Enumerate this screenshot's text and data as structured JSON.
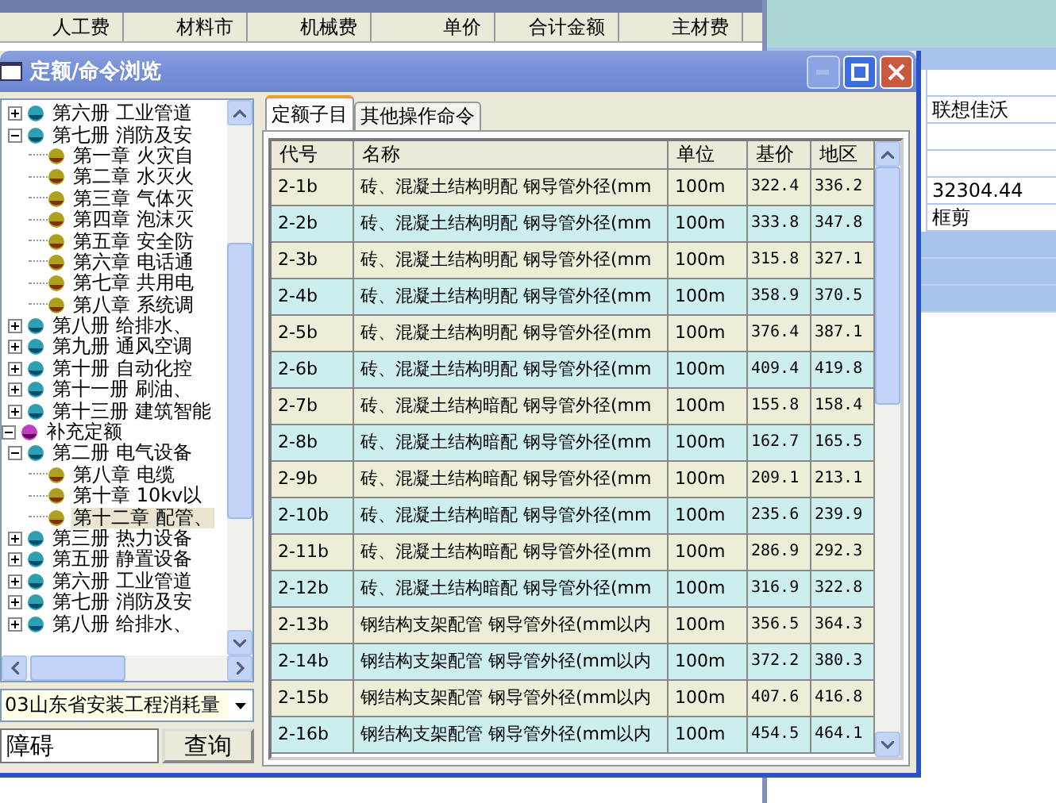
{
  "background": {
    "columns": [
      "人工费",
      "材料市",
      "机械费",
      "单价",
      "合计金额",
      "主材费"
    ],
    "side_cells": [
      "",
      "联想佳沃",
      "",
      "",
      "32304.44",
      "框剪"
    ]
  },
  "window": {
    "title": "定额/命令浏览"
  },
  "tree": [
    {
      "children": [
        {
          "label": "第六册  工业管道",
          "kind": "book",
          "expanded": false
        },
        {
          "label": "第七册  消防及安",
          "kind": "book",
          "expanded": true,
          "children": [
            {
              "label": "第一章  火灾自",
              "kind": "chapter",
              "selected": false
            },
            {
              "label": "第二章  水灭火",
              "kind": "chapter",
              "selected": false
            },
            {
              "label": "第三章  气体灭",
              "kind": "chapter",
              "selected": false
            },
            {
              "label": "第四章  泡沫灭",
              "kind": "chapter",
              "selected": false
            },
            {
              "label": "第五章  安全防",
              "kind": "chapter",
              "selected": false
            },
            {
              "label": "第六章  电话通",
              "kind": "chapter",
              "selected": false
            },
            {
              "label": "第七章  共用电",
              "kind": "chapter",
              "selected": false
            },
            {
              "label": "第八章  系统调",
              "kind": "chapter",
              "selected": false
            }
          ]
        },
        {
          "label": "第八册  给排水、",
          "kind": "book",
          "expanded": false
        },
        {
          "label": "第九册  通风空调",
          "kind": "book",
          "expanded": false
        },
        {
          "label": "第十册  自动化控",
          "kind": "book",
          "expanded": false
        },
        {
          "label": "第十一册  刷油、",
          "kind": "book",
          "expanded": false
        },
        {
          "label": "第十三册  建筑智能",
          "kind": "book",
          "expanded": false
        }
      ]
    },
    {
      "label": "补充定额",
      "kind": "root",
      "expanded": true,
      "children": [
        {
          "label": "第二册  电气设备",
          "kind": "book",
          "expanded": true,
          "children": [
            {
              "label": "第八章  电缆",
              "kind": "chapter",
              "selected": false
            },
            {
              "label": "第十章  10kv以",
              "kind": "chapter",
              "selected": false
            },
            {
              "label": "第十二章  配管、",
              "kind": "chapter",
              "selected": true
            }
          ]
        },
        {
          "label": "第三册  热力设备",
          "kind": "book",
          "expanded": false
        },
        {
          "label": "第五册  静置设备",
          "kind": "book",
          "expanded": false
        },
        {
          "label": "第六册  工业管道",
          "kind": "book",
          "expanded": false
        },
        {
          "label": "第七册  消防及安",
          "kind": "book",
          "expanded": false
        },
        {
          "label": "第八册  给排水、",
          "kind": "book",
          "expanded": false
        }
      ]
    }
  ],
  "library_select": {
    "value": "03山东省安装工程消耗量"
  },
  "search": {
    "value": "障碍",
    "button": "查询"
  },
  "tabs": [
    {
      "label": "定额子目",
      "selected": true
    },
    {
      "label": "其他操作命令",
      "selected": false
    }
  ],
  "table": {
    "columns": [
      "代号",
      "名称",
      "单位",
      "基价",
      "地区"
    ],
    "rows": [
      [
        "2-1b",
        "砖、混凝土结构明配 钢导管外径(mm",
        "100m",
        "322.4",
        "336.2"
      ],
      [
        "2-2b",
        "砖、混凝土结构明配 钢导管外径(mm",
        "100m",
        "333.8",
        "347.8"
      ],
      [
        "2-3b",
        "砖、混凝土结构明配 钢导管外径(mm",
        "100m",
        "315.8",
        "327.1"
      ],
      [
        "2-4b",
        "砖、混凝土结构明配 钢导管外径(mm",
        "100m",
        "358.9",
        "370.5"
      ],
      [
        "2-5b",
        "砖、混凝土结构明配 钢导管外径(mm",
        "100m",
        "376.4",
        "387.1"
      ],
      [
        "2-6b",
        "砖、混凝土结构明配 钢导管外径(mm",
        "100m",
        "409.4",
        "419.8"
      ],
      [
        "2-7b",
        "砖、混凝土结构暗配 钢导管外径(mm",
        "100m",
        "155.8",
        "158.4"
      ],
      [
        "2-8b",
        "砖、混凝土结构暗配 钢导管外径(mm",
        "100m",
        "162.7",
        "165.5"
      ],
      [
        "2-9b",
        "砖、混凝土结构暗配 钢导管外径(mm",
        "100m",
        "209.1",
        "213.1"
      ],
      [
        "2-10b",
        "砖、混凝土结构暗配 钢导管外径(mm",
        "100m",
        "235.6",
        "239.9"
      ],
      [
        "2-11b",
        "砖、混凝土结构暗配 钢导管外径(mm",
        "100m",
        "286.9",
        "292.3"
      ],
      [
        "2-12b",
        "砖、混凝土结构暗配 钢导管外径(mm",
        "100m",
        "316.9",
        "322.8"
      ],
      [
        "2-13b",
        "钢结构支架配管 钢导管外径(mm以内",
        "100m",
        "356.5",
        "364.3"
      ],
      [
        "2-14b",
        "钢结构支架配管 钢导管外径(mm以内",
        "100m",
        "372.2",
        "380.3"
      ],
      [
        "2-15b",
        "钢结构支架配管 钢导管外径(mm以内",
        "100m",
        "407.6",
        "416.8"
      ],
      [
        "2-16b",
        "钢结构支架配管 钢导管外径(mm以内",
        "100m",
        "454.5",
        "464.1"
      ]
    ]
  }
}
